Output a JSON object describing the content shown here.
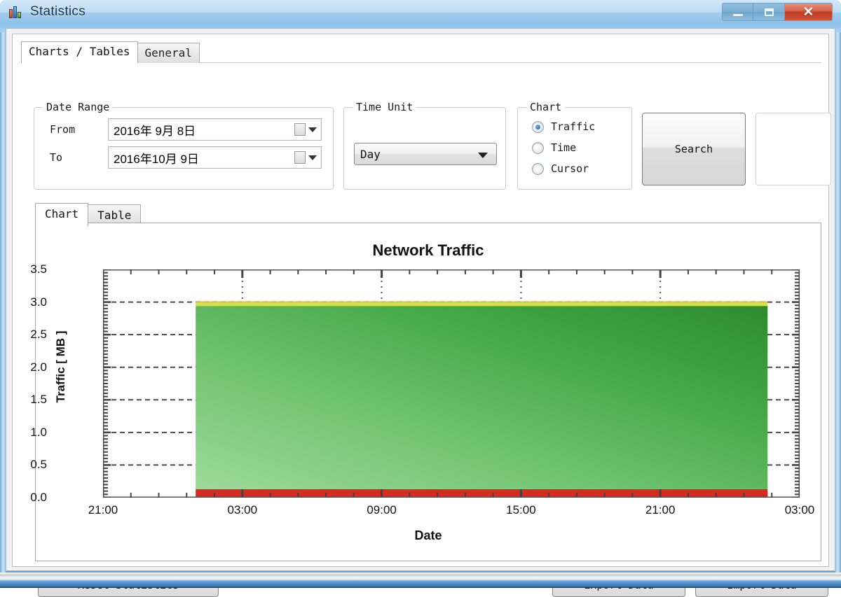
{
  "window": {
    "title": "Statistics",
    "icon": "bar-chart-icon",
    "buttons": {
      "minimize": "minimize-icon",
      "maximize": "maximize-icon",
      "close": "✕"
    }
  },
  "top_tabs": [
    {
      "label": "Charts / Tables",
      "active": true
    },
    {
      "label": "General",
      "active": false
    }
  ],
  "date_range": {
    "legend": "Date Range",
    "from_label": "From",
    "from_value": "2016年 9月 8日",
    "to_label": "To",
    "to_value": "2016年10月 9日"
  },
  "time_unit": {
    "legend": "Time Unit",
    "selected": "Day",
    "options": [
      "Day"
    ]
  },
  "chart_group": {
    "legend": "Chart",
    "options": [
      {
        "label": "Traffic",
        "selected": true
      },
      {
        "label": "Time",
        "selected": false
      },
      {
        "label": "Cursor",
        "selected": false
      }
    ]
  },
  "search_button": "Search",
  "sub_tabs": [
    {
      "label": "Chart",
      "active": true
    },
    {
      "label": "Table",
      "active": false
    }
  ],
  "bottom_buttons": {
    "reset": "Reset Statistics",
    "export": "Export Data",
    "import": "Import Data"
  },
  "colors": {
    "accent_blue": "#3b7db8",
    "green_light": "#7fcf7f",
    "green_dark": "#2f8f2f",
    "yellow_band": "#d6e04a",
    "orange_line": "#f0a030",
    "red_band": "#d62b1f",
    "close_red": "#bf3b25"
  },
  "chart_data": {
    "type": "area",
    "title": "Network Traffic",
    "xlabel": "Date",
    "ylabel": "Traffic [ MB ]",
    "ylim": [
      0.0,
      3.5
    ],
    "ytick_labels": [
      "0.0",
      "0.5",
      "1.0",
      "1.5",
      "2.0",
      "2.5",
      "3.0",
      "3.5"
    ],
    "ytick_values": [
      0.0,
      0.5,
      1.0,
      1.5,
      2.0,
      2.5,
      3.0,
      3.5
    ],
    "xtick_labels": [
      "21:00",
      "03:00",
      "09:00",
      "15:00",
      "21:00",
      "03:00"
    ],
    "xtick_positions": [
      0,
      0.2,
      0.4,
      0.6,
      0.8,
      1.0
    ],
    "grid": "dashed-horizontal-and-dotted-vertical",
    "legend": "none",
    "data_span_fraction": [
      0.133,
      0.954
    ],
    "series": [
      {
        "name": "red-band",
        "color": "#d62b1f",
        "y_from": 0.0,
        "y_to": 0.13
      },
      {
        "name": "green-fill",
        "color": "#4caf50",
        "y_from": 0.13,
        "y_to": 2.94
      },
      {
        "name": "yellow-band",
        "color": "#d6e04a",
        "y_from": 2.94,
        "y_to": 3.0
      },
      {
        "name": "orange-line",
        "color": "#f0a030",
        "y_from": 3.0,
        "y_to": 3.01
      }
    ],
    "values": [
      3.0
    ]
  }
}
